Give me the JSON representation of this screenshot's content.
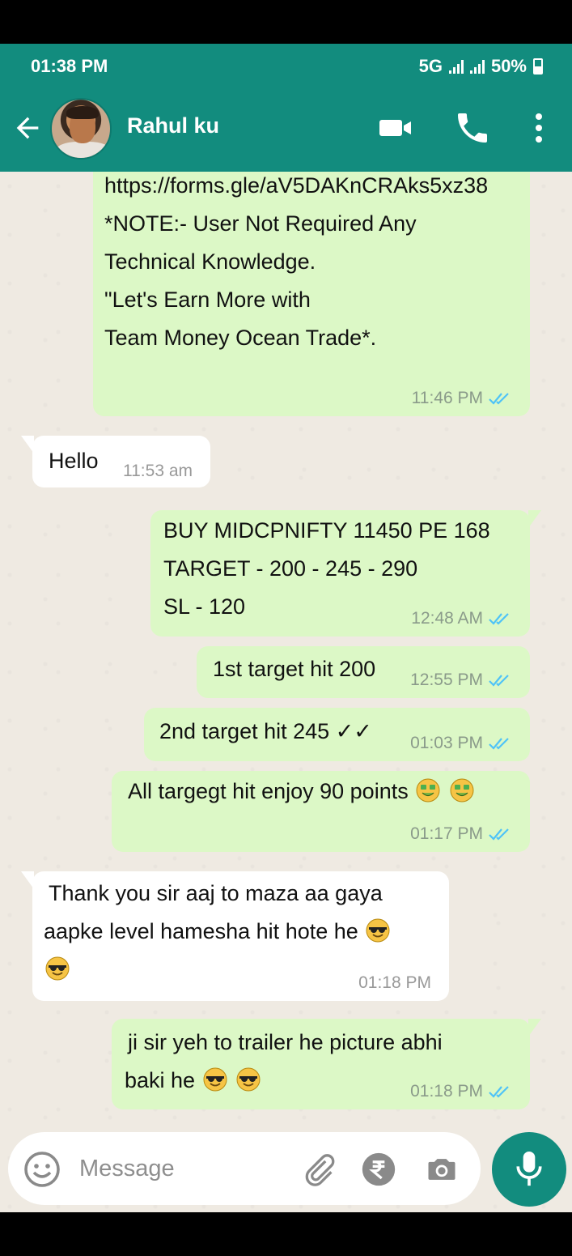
{
  "status_bar": {
    "time": "01:38 PM",
    "network": "5G",
    "battery": "50%"
  },
  "header": {
    "contact_name": "Rahul ku"
  },
  "colors": {
    "brand": "#128c7e",
    "outgoing_bubble": "#dcf8c6",
    "incoming_bubble": "#ffffff",
    "read_tick": "#4fc3f7",
    "chat_bg": "#efeae2"
  },
  "messages": [
    {
      "direction": "out",
      "text": "https://forms.gle/aV5DAKnCRAks5xz38\n*NOTE:- User Not Required Any\nTechnical Knowledge.\n\"Let's Earn More with\nTeam Money Ocean Trade*.",
      "time": "11:46 PM",
      "status": "read"
    },
    {
      "direction": "in",
      "text": "Hello",
      "time": "11:53 am"
    },
    {
      "direction": "out",
      "text": "BUY MIDCPNIFTY 11450 PE 168\nTARGET - 200 - 245 - 290\nSL - 120",
      "time": "12:48 AM",
      "status": "read"
    },
    {
      "direction": "out",
      "text": "1st target hit 200",
      "time": "12:55 PM",
      "status": "read"
    },
    {
      "direction": "out",
      "text": "2nd target hit 245 ✓✓",
      "time": "01:03 PM",
      "status": "read"
    },
    {
      "direction": "out",
      "text": "All targegt hit enjoy 90 points",
      "emoji": [
        "money-mouth-face",
        "money-mouth-face"
      ],
      "time": "01:17 PM",
      "status": "read"
    },
    {
      "direction": "in",
      "text_line1": "Thank you sir  aaj to maza aa gaya",
      "text_line2": "aapke level hamesha hit hote he",
      "emoji": [
        "smiling-face-with-sunglasses",
        "smiling-face-with-sunglasses"
      ],
      "time": "01:18 PM"
    },
    {
      "direction": "out",
      "text_line1": "ji sir yeh to trailer he picture abhi",
      "text_line2": "baki he",
      "emoji": [
        "smiling-face-with-sunglasses",
        "smiling-face-with-sunglasses"
      ],
      "time": "01:18 PM",
      "status": "read"
    }
  ],
  "composer": {
    "placeholder": "Message"
  },
  "icons": [
    "back-arrow-icon",
    "video-call-icon",
    "phone-icon",
    "more-vert-icon",
    "emoji-icon",
    "attach-icon",
    "rupee-payment-icon",
    "camera-icon",
    "mic-icon"
  ]
}
